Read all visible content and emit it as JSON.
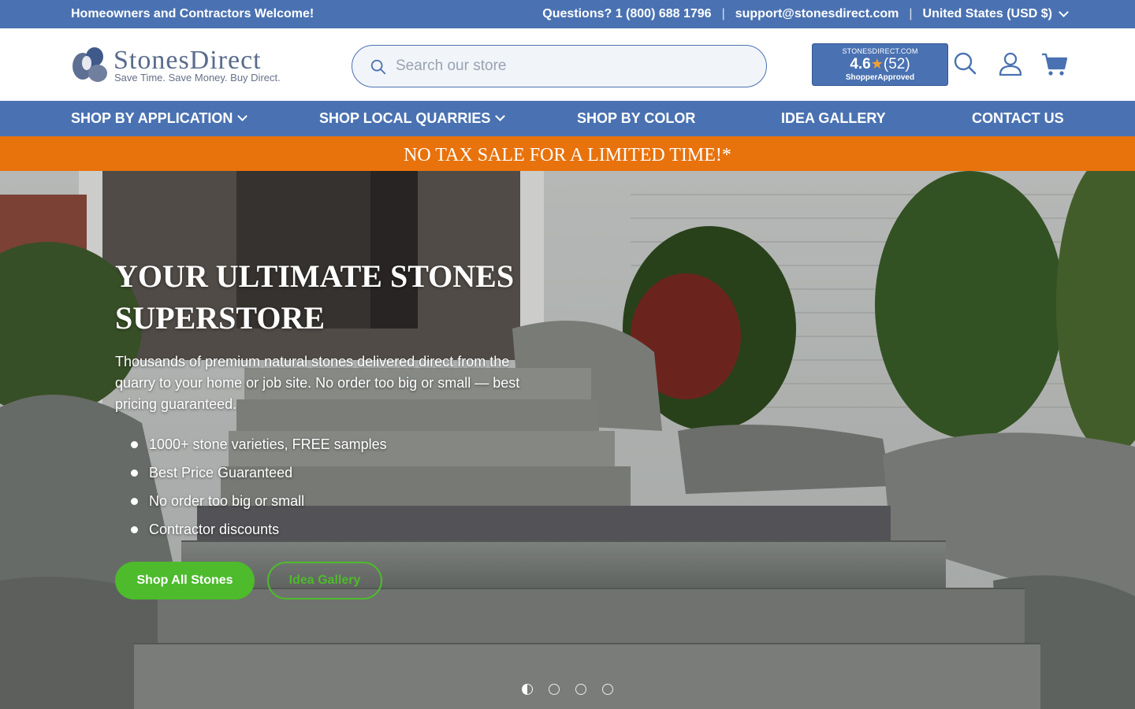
{
  "topbar": {
    "welcome": "Homeowners and Contractors Welcome!",
    "phone": "Questions? 1 (800) 688 1796",
    "email": "support@stonesdirect.com",
    "country": "United States (USD $)",
    "separator": "|"
  },
  "header": {
    "logo_name": "StonesDirect",
    "logo_tagline": "Save Time. Save Money. Buy Direct.",
    "search_placeholder": "Search our store",
    "rating_badge": {
      "site": "STONESDIRECT.COM",
      "score": "4.6",
      "star": "★",
      "count": "(52)",
      "brand": "ShopperApproved"
    },
    "icons": [
      "search-icon",
      "account-icon",
      "cart-icon"
    ]
  },
  "nav": {
    "items": [
      {
        "label": "SHOP BY APPLICATION",
        "has_dropdown": true
      },
      {
        "label": "SHOP LOCAL QUARRIES",
        "has_dropdown": true
      },
      {
        "label": "SHOP BY COLOR",
        "has_dropdown": false
      },
      {
        "label": "IDEA GALLERY",
        "has_dropdown": false
      },
      {
        "label": "CONTACT US",
        "has_dropdown": false
      }
    ]
  },
  "promo": {
    "text": "NO TAX SALE FOR A LIMITED TIME!*"
  },
  "hero": {
    "title": "YOUR ULTIMATE STONES SUPERSTORE",
    "description": "Thousands of premium natural stones delivered direct from the quarry to your home or job site. No order too big or small — best pricing guaranteed.",
    "bullets": [
      "1000+ stone varieties, FREE samples",
      "Best Price Guaranteed",
      "No order too big or small",
      "Contractor discounts"
    ],
    "primary_button": "Shop All Stones",
    "secondary_button": "Idea Gallery",
    "slides": {
      "count": 4,
      "active": 1
    }
  },
  "colors": {
    "brand_blue": "#4a72b2",
    "promo_orange": "#e8720c",
    "cta_green": "#4dbb2c",
    "star_orange": "#f2a12e"
  }
}
